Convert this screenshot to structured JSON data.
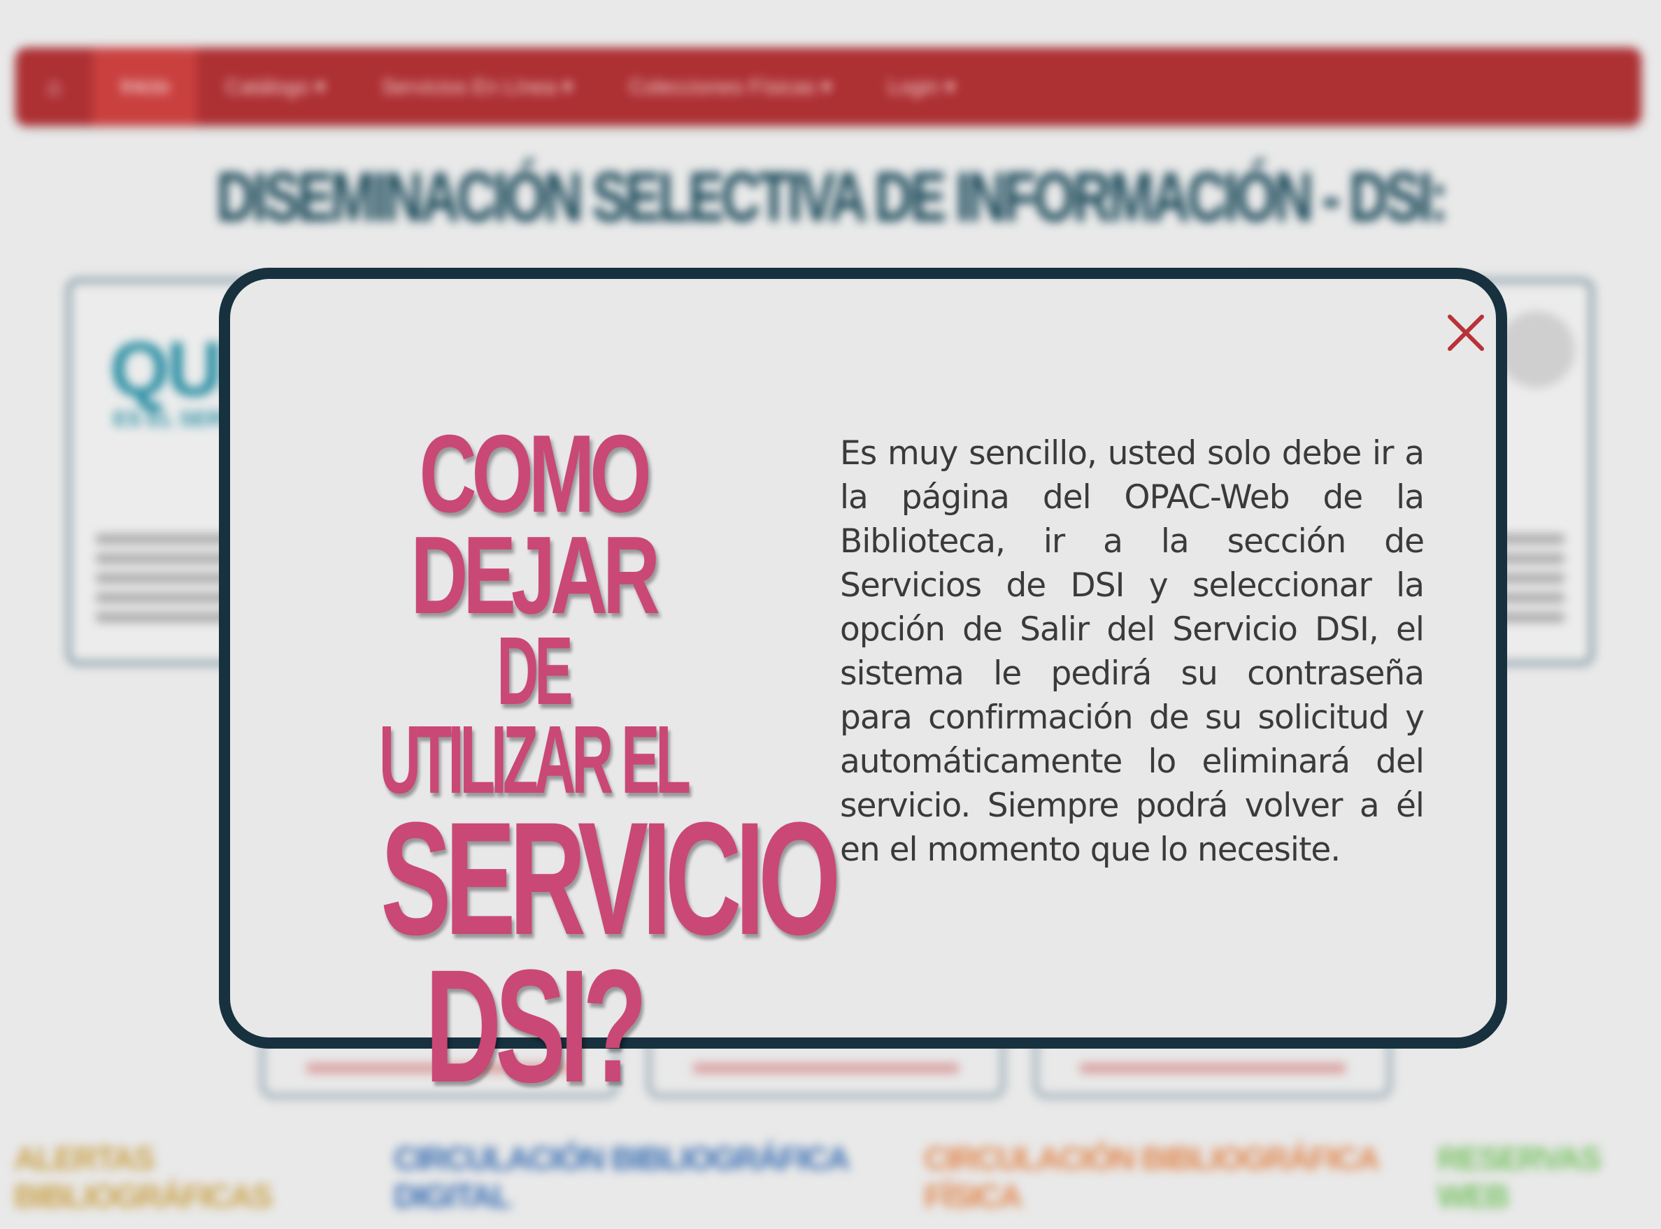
{
  "navbar": {
    "home_icon": "home-icon",
    "items": [
      {
        "label": "Inicio"
      },
      {
        "label": "Catálogo ▾"
      },
      {
        "label": "Servicios En Línea ▾"
      },
      {
        "label": "Colecciones Físicas ▾"
      },
      {
        "label": "Login ▾"
      }
    ]
  },
  "page": {
    "heading": "DISEMINACIÓN SELECTIVA DE INFORMACIÓN - DSI:",
    "left_card_big": "QUE",
    "left_card_sub": "ES EL SERV"
  },
  "bottom_links": [
    "ALERTAS BIBLIOGRÁFICAS",
    "CIRCULACIÓN BIBLIOGRÁFICA DIGITAL",
    "CIRCULACIÓN BIBLIOGRÁFICA FÍSICA",
    "RESERVAS WEB"
  ],
  "modal": {
    "close_icon": "close-icon",
    "title_line1": "COMO DEJAR",
    "title_line2": "DE UTILIZAR EL",
    "title_line3": "SERVICIO",
    "title_line4": "DSI?",
    "body": "Es muy sencillo, usted solo debe ir a la página del OPAC-Web de la Biblioteca, ir a la sección de Servicios de DSI y seleccionar la opción de Salir del Servicio DSI, el sistema le pedirá su contraseña para confirmación de su solicitud y automáticamente lo eliminará del servicio. Siempre podrá volver a él en el momento que lo necesite."
  },
  "colors": {
    "navbar": "#ad3033",
    "modal_border": "#17313f",
    "title": "#c94876",
    "close": "#b83238",
    "heading": "#1b4a5a"
  }
}
